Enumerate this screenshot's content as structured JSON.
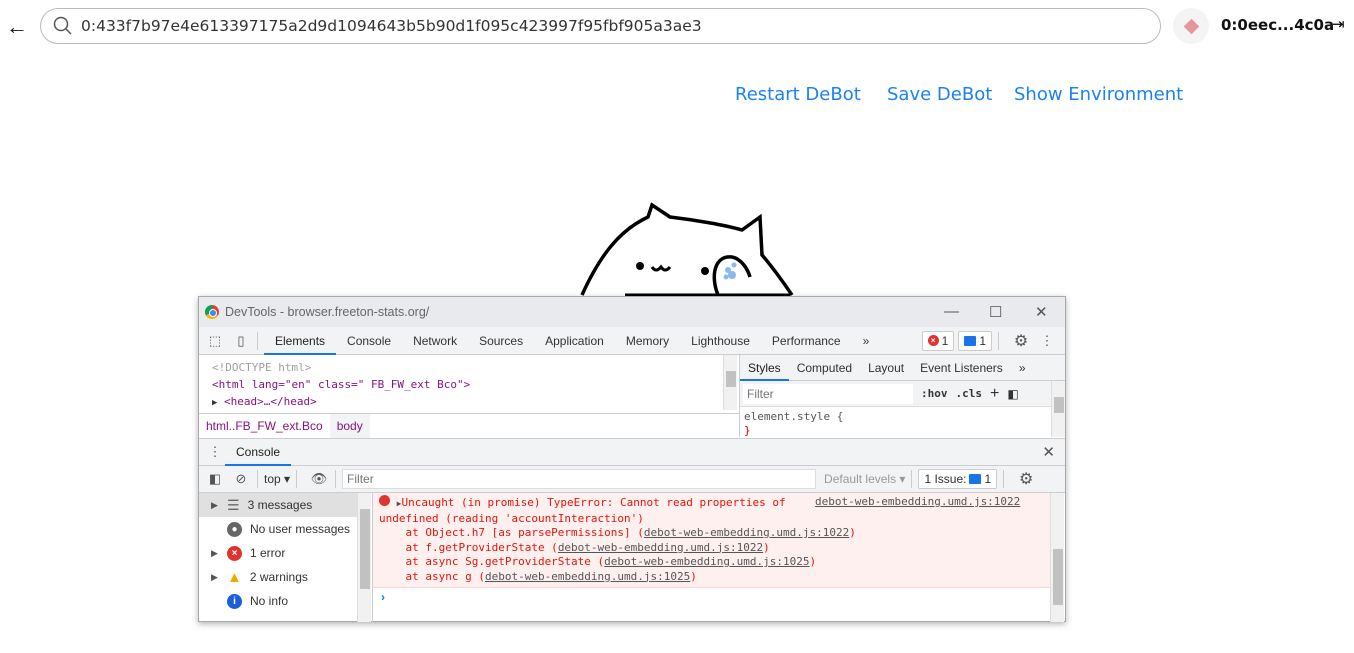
{
  "browser": {
    "address": "0:433f7b97e4e613397175a2d9d1094643b5b90d1f095c423997f95fbf905a3ae3",
    "account": "0:0eec...4c0a"
  },
  "links": {
    "restart": "Restart DeBot",
    "save": "Save DeBot",
    "env": "Show Environment"
  },
  "devtools": {
    "title": "DevTools - browser.freeton-stats.org/",
    "tabs": [
      "Elements",
      "Console",
      "Network",
      "Sources",
      "Application",
      "Memory",
      "Lighthouse",
      "Performance"
    ],
    "more": "»",
    "error_count": "1",
    "message_count": "1",
    "elements": {
      "doctype": "<!DOCTYPE html>",
      "html_open": "<html lang=\"en\" class=\" FB_FW_ext Bco\">",
      "head": "<head>…</head>"
    },
    "styles_tabs": [
      "Styles",
      "Computed",
      "Layout",
      "Event Listeners"
    ],
    "styles_filter_placeholder": "Filter",
    "hov": ":hov",
    "cls": ".cls",
    "plus": "+",
    "element_style": "element.style {",
    "element_style_close": "}",
    "breadcrumbs": [
      "html..FB_FW_ext.Bco",
      "body"
    ],
    "drawer_tab": "Console",
    "console_toolbar": {
      "context": "top",
      "filter_placeholder": "Filter",
      "levels": "Default levels",
      "issues": "1 Issue:",
      "issues_count": "1"
    },
    "sidebar": [
      {
        "label": "3 messages",
        "icon": "list-icon",
        "expandable": true
      },
      {
        "label": "No user messages",
        "icon": "user-icon",
        "expandable": false
      },
      {
        "label": "1 error",
        "icon": "error-icon",
        "expandable": true
      },
      {
        "label": "2 warnings",
        "icon": "warning-icon",
        "expandable": true
      },
      {
        "label": "No info",
        "icon": "info-icon",
        "expandable": false
      }
    ],
    "error": {
      "line1": "Uncaught (in promise) TypeError: Cannot read properties of",
      "source": "debot-web-embedding.umd.js:1022",
      "line2": "undefined (reading 'accountInteraction')",
      "stack": [
        {
          "text": "    at Object.h7 [as parsePermissions] (",
          "link": "debot-web-embedding.umd.js:1022"
        },
        {
          "text": "    at f.getProviderState (",
          "link": "debot-web-embedding.umd.js:1022"
        },
        {
          "text": "    at async Sg.getProviderState (",
          "link": "debot-web-embedding.umd.js:1025"
        },
        {
          "text": "    at async g (",
          "link": "debot-web-embedding.umd.js:1025"
        }
      ]
    },
    "prompt": "›"
  }
}
